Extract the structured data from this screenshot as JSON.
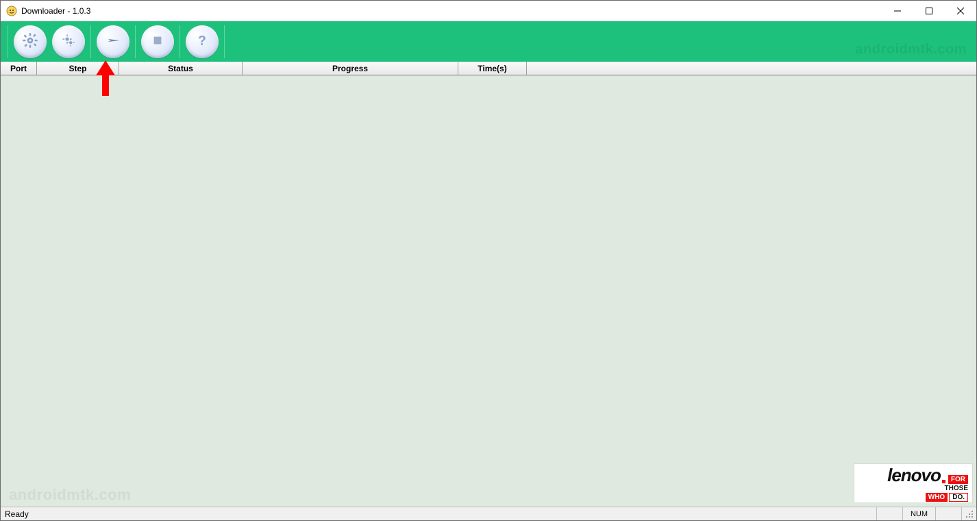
{
  "window": {
    "title": "Downloader - 1.0.3"
  },
  "toolbar": {
    "buttons": [
      {
        "name": "settings-gear-button"
      },
      {
        "name": "settings-double-gear-button"
      },
      {
        "name": "start-play-button"
      },
      {
        "name": "stop-button"
      },
      {
        "name": "help-button"
      }
    ]
  },
  "headers": {
    "port": "Port",
    "step": "Step",
    "status": "Status",
    "progress": "Progress",
    "times": "Time(s)"
  },
  "watermark": "androidmtk.com",
  "badge": {
    "brand": "lenovo",
    "for": "FOR",
    "those": "THOSE",
    "who": "WHO",
    "do": "DO."
  },
  "statusbar": {
    "ready": "Ready",
    "num": "NUM"
  },
  "annotation": {
    "points_to": "start-play-button",
    "color": "#ff0000"
  }
}
